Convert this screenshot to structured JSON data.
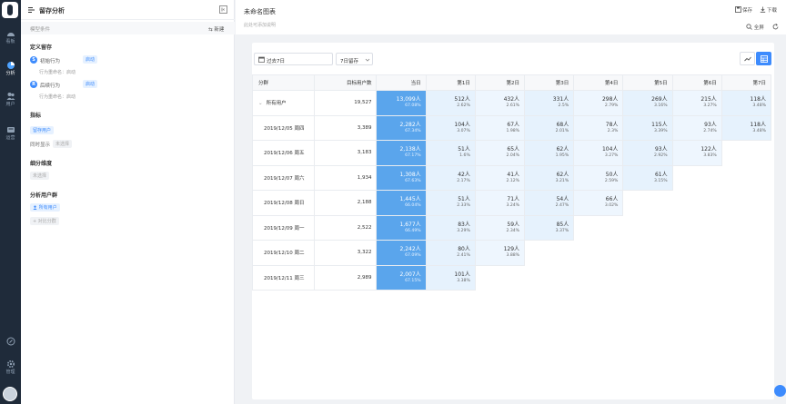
{
  "rail": {
    "items": [
      {
        "label": "看板",
        "icon": "dashboard-icon"
      },
      {
        "label": "分析",
        "icon": "analysis-icon"
      },
      {
        "label": "用户",
        "icon": "users-icon"
      },
      {
        "label": "运营",
        "icon": "operation-icon"
      },
      {
        "label": "管理",
        "icon": "settings-icon"
      }
    ]
  },
  "panel": {
    "title": "留存分析",
    "model_label": "模型条件",
    "new_label": "新建",
    "define_title": "定义留存",
    "initial": {
      "badge": "S",
      "label": "初始行为",
      "tag": "启动",
      "sub": "行为重命名：启动"
    },
    "return": {
      "badge": "R",
      "label": "后续行为",
      "tag": "启动",
      "sub": "行为重命名：启动"
    },
    "metric_title": "指标",
    "metric_tag": "留存用户",
    "compare_label": "同时显示",
    "compare_tag": "未选择",
    "breakdown_title": "细分维度",
    "breakdown_tag": "未选择",
    "cohort_title": "分析用户群",
    "cohort_tag": "所有用户",
    "cohort_add": "+ 对比分群"
  },
  "main": {
    "chart_title": "未命名图表",
    "chart_desc": "此处可添加说明",
    "save_label": "保存",
    "download_label": "下载",
    "fullscreen_label": "全屏",
    "date_range": "过去7日",
    "retention_window": "7日留存",
    "accent": "#3d8bfd",
    "day0_color": "#5aa5ec"
  },
  "table": {
    "headers": [
      "分群",
      "目标用户数",
      "当日",
      "第1日",
      "第2日",
      "第3日",
      "第4日",
      "第5日",
      "第6日",
      "第7日"
    ],
    "rows": [
      {
        "group": "所有用户",
        "total": "19,527",
        "cells": [
          {
            "c": "13,099人",
            "p": "67.08%"
          },
          {
            "c": "512人",
            "p": "2.62%"
          },
          {
            "c": "432人",
            "p": "2.61%"
          },
          {
            "c": "331人",
            "p": "2.5%"
          },
          {
            "c": "298人",
            "p": "2.79%"
          },
          {
            "c": "269人",
            "p": "3.16%"
          },
          {
            "c": "215人",
            "p": "3.27%"
          },
          {
            "c": "118人",
            "p": "3.48%"
          }
        ]
      },
      {
        "group": "2019/12/05 周四",
        "total": "3,389",
        "cells": [
          {
            "c": "2,282人",
            "p": "67.34%"
          },
          {
            "c": "104人",
            "p": "3.07%"
          },
          {
            "c": "67人",
            "p": "1.98%"
          },
          {
            "c": "68人",
            "p": "2.01%"
          },
          {
            "c": "78人",
            "p": "2.3%"
          },
          {
            "c": "115人",
            "p": "3.39%"
          },
          {
            "c": "93人",
            "p": "2.74%"
          },
          {
            "c": "118人",
            "p": "3.48%"
          }
        ]
      },
      {
        "group": "2019/12/06 周五",
        "total": "3,183",
        "cells": [
          {
            "c": "2,138人",
            "p": "67.17%"
          },
          {
            "c": "51人",
            "p": "1.6%"
          },
          {
            "c": "65人",
            "p": "2.04%"
          },
          {
            "c": "62人",
            "p": "1.95%"
          },
          {
            "c": "104人",
            "p": "3.27%"
          },
          {
            "c": "93人",
            "p": "2.92%"
          },
          {
            "c": "122人",
            "p": "3.83%"
          },
          null
        ]
      },
      {
        "group": "2019/12/07 周六",
        "total": "1,934",
        "cells": [
          {
            "c": "1,308人",
            "p": "67.63%"
          },
          {
            "c": "42人",
            "p": "2.17%"
          },
          {
            "c": "41人",
            "p": "2.12%"
          },
          {
            "c": "62人",
            "p": "3.21%"
          },
          {
            "c": "50人",
            "p": "2.59%"
          },
          {
            "c": "61人",
            "p": "3.15%"
          },
          null,
          null
        ]
      },
      {
        "group": "2019/12/08 周日",
        "total": "2,188",
        "cells": [
          {
            "c": "1,445人",
            "p": "66.04%"
          },
          {
            "c": "51人",
            "p": "2.33%"
          },
          {
            "c": "71人",
            "p": "3.24%"
          },
          {
            "c": "54人",
            "p": "2.47%"
          },
          {
            "c": "66人",
            "p": "3.02%"
          },
          null,
          null,
          null
        ]
      },
      {
        "group": "2019/12/09 周一",
        "total": "2,522",
        "cells": [
          {
            "c": "1,677人",
            "p": "66.49%"
          },
          {
            "c": "83人",
            "p": "3.29%"
          },
          {
            "c": "59人",
            "p": "2.34%"
          },
          {
            "c": "85人",
            "p": "3.37%"
          },
          null,
          null,
          null,
          null
        ]
      },
      {
        "group": "2019/12/10 周二",
        "total": "3,322",
        "cells": [
          {
            "c": "2,242人",
            "p": "67.09%"
          },
          {
            "c": "80人",
            "p": "2.41%"
          },
          {
            "c": "129人",
            "p": "3.88%"
          },
          null,
          null,
          null,
          null,
          null
        ]
      },
      {
        "group": "2019/12/11 周三",
        "total": "2,989",
        "cells": [
          {
            "c": "2,007人",
            "p": "67.15%"
          },
          {
            "c": "101人",
            "p": "3.38%"
          },
          null,
          null,
          null,
          null,
          null,
          null
        ]
      }
    ]
  }
}
